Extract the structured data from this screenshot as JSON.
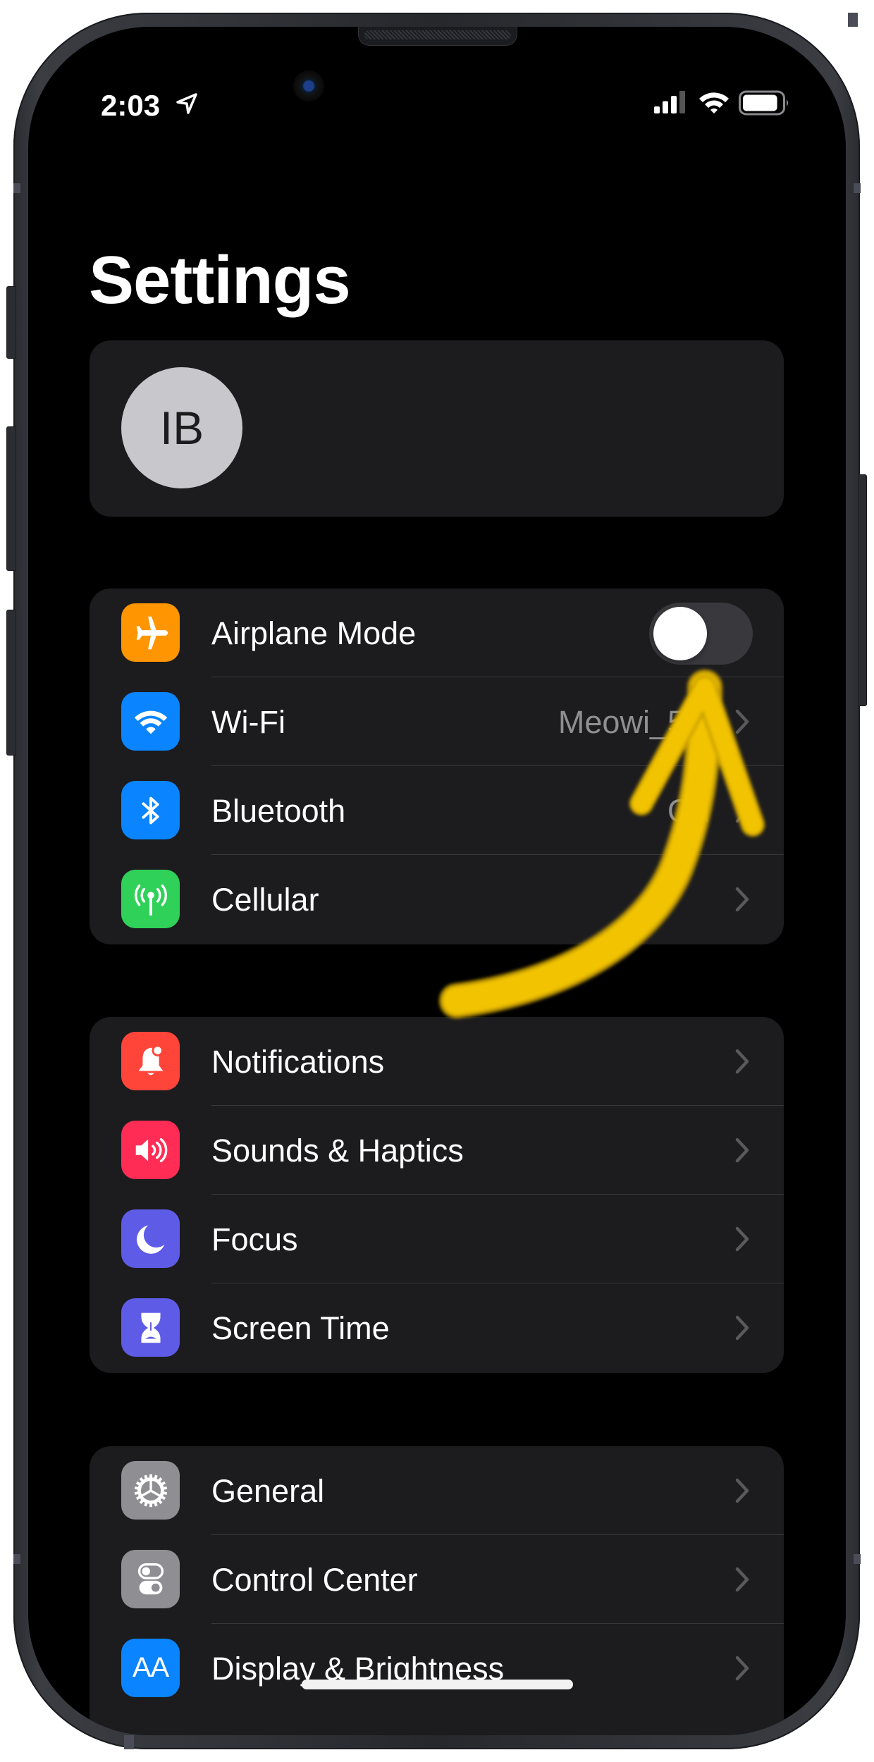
{
  "status_bar": {
    "time": "2:03",
    "location_icon": "location-arrow-icon",
    "signal_bars_filled": 3,
    "signal_bars_total": 4,
    "wifi_icon": "wifi-status-icon",
    "battery_level_percent": 90
  },
  "page": {
    "title": "Settings"
  },
  "profile": {
    "initials": "IB"
  },
  "groups": [
    {
      "rows": [
        {
          "label": "Airplane Mode",
          "icon": "airplane-icon",
          "icon_color": "#ff9500",
          "control": "toggle",
          "toggle_on": false
        },
        {
          "label": "Wi-Fi",
          "icon": "wifi-icon",
          "icon_color": "#0a84ff",
          "value": "Meowi_5G",
          "control": "chevron"
        },
        {
          "label": "Bluetooth",
          "icon": "bluetooth-icon",
          "icon_color": "#0a84ff",
          "value": "On",
          "control": "chevron"
        },
        {
          "label": "Cellular",
          "icon": "cellular-antenna-icon",
          "icon_color": "#30d158",
          "control": "chevron"
        }
      ]
    },
    {
      "rows": [
        {
          "label": "Notifications",
          "icon": "bell-icon",
          "icon_color": "#ff453a",
          "control": "chevron"
        },
        {
          "label": "Sounds & Haptics",
          "icon": "speaker-icon",
          "icon_color": "#ff2d55",
          "control": "chevron"
        },
        {
          "label": "Focus",
          "icon": "moon-icon",
          "icon_color": "#5e5ce6",
          "control": "chevron"
        },
        {
          "label": "Screen Time",
          "icon": "hourglass-icon",
          "icon_color": "#5e5ce6",
          "control": "chevron"
        }
      ]
    },
    {
      "rows": [
        {
          "label": "General",
          "icon": "gear-icon",
          "icon_color": "#8e8e93",
          "control": "chevron"
        },
        {
          "label": "Control Center",
          "icon": "switches-icon",
          "icon_color": "#8e8e93",
          "control": "chevron"
        },
        {
          "label": "Display & Brightness",
          "icon": "text-size-icon",
          "icon_glyph": "AA",
          "icon_color": "#0a84ff",
          "control": "chevron"
        }
      ]
    }
  ],
  "annotation": {
    "type": "hand-drawn-arrow",
    "color": "#f2c300",
    "points_to": "Airplane Mode toggle"
  },
  "colors": {
    "background": "#000000",
    "card": "#1c1c1e",
    "separator": "#38383a",
    "secondary_text": "#8e8e93",
    "chevron": "#5a5a5e"
  }
}
